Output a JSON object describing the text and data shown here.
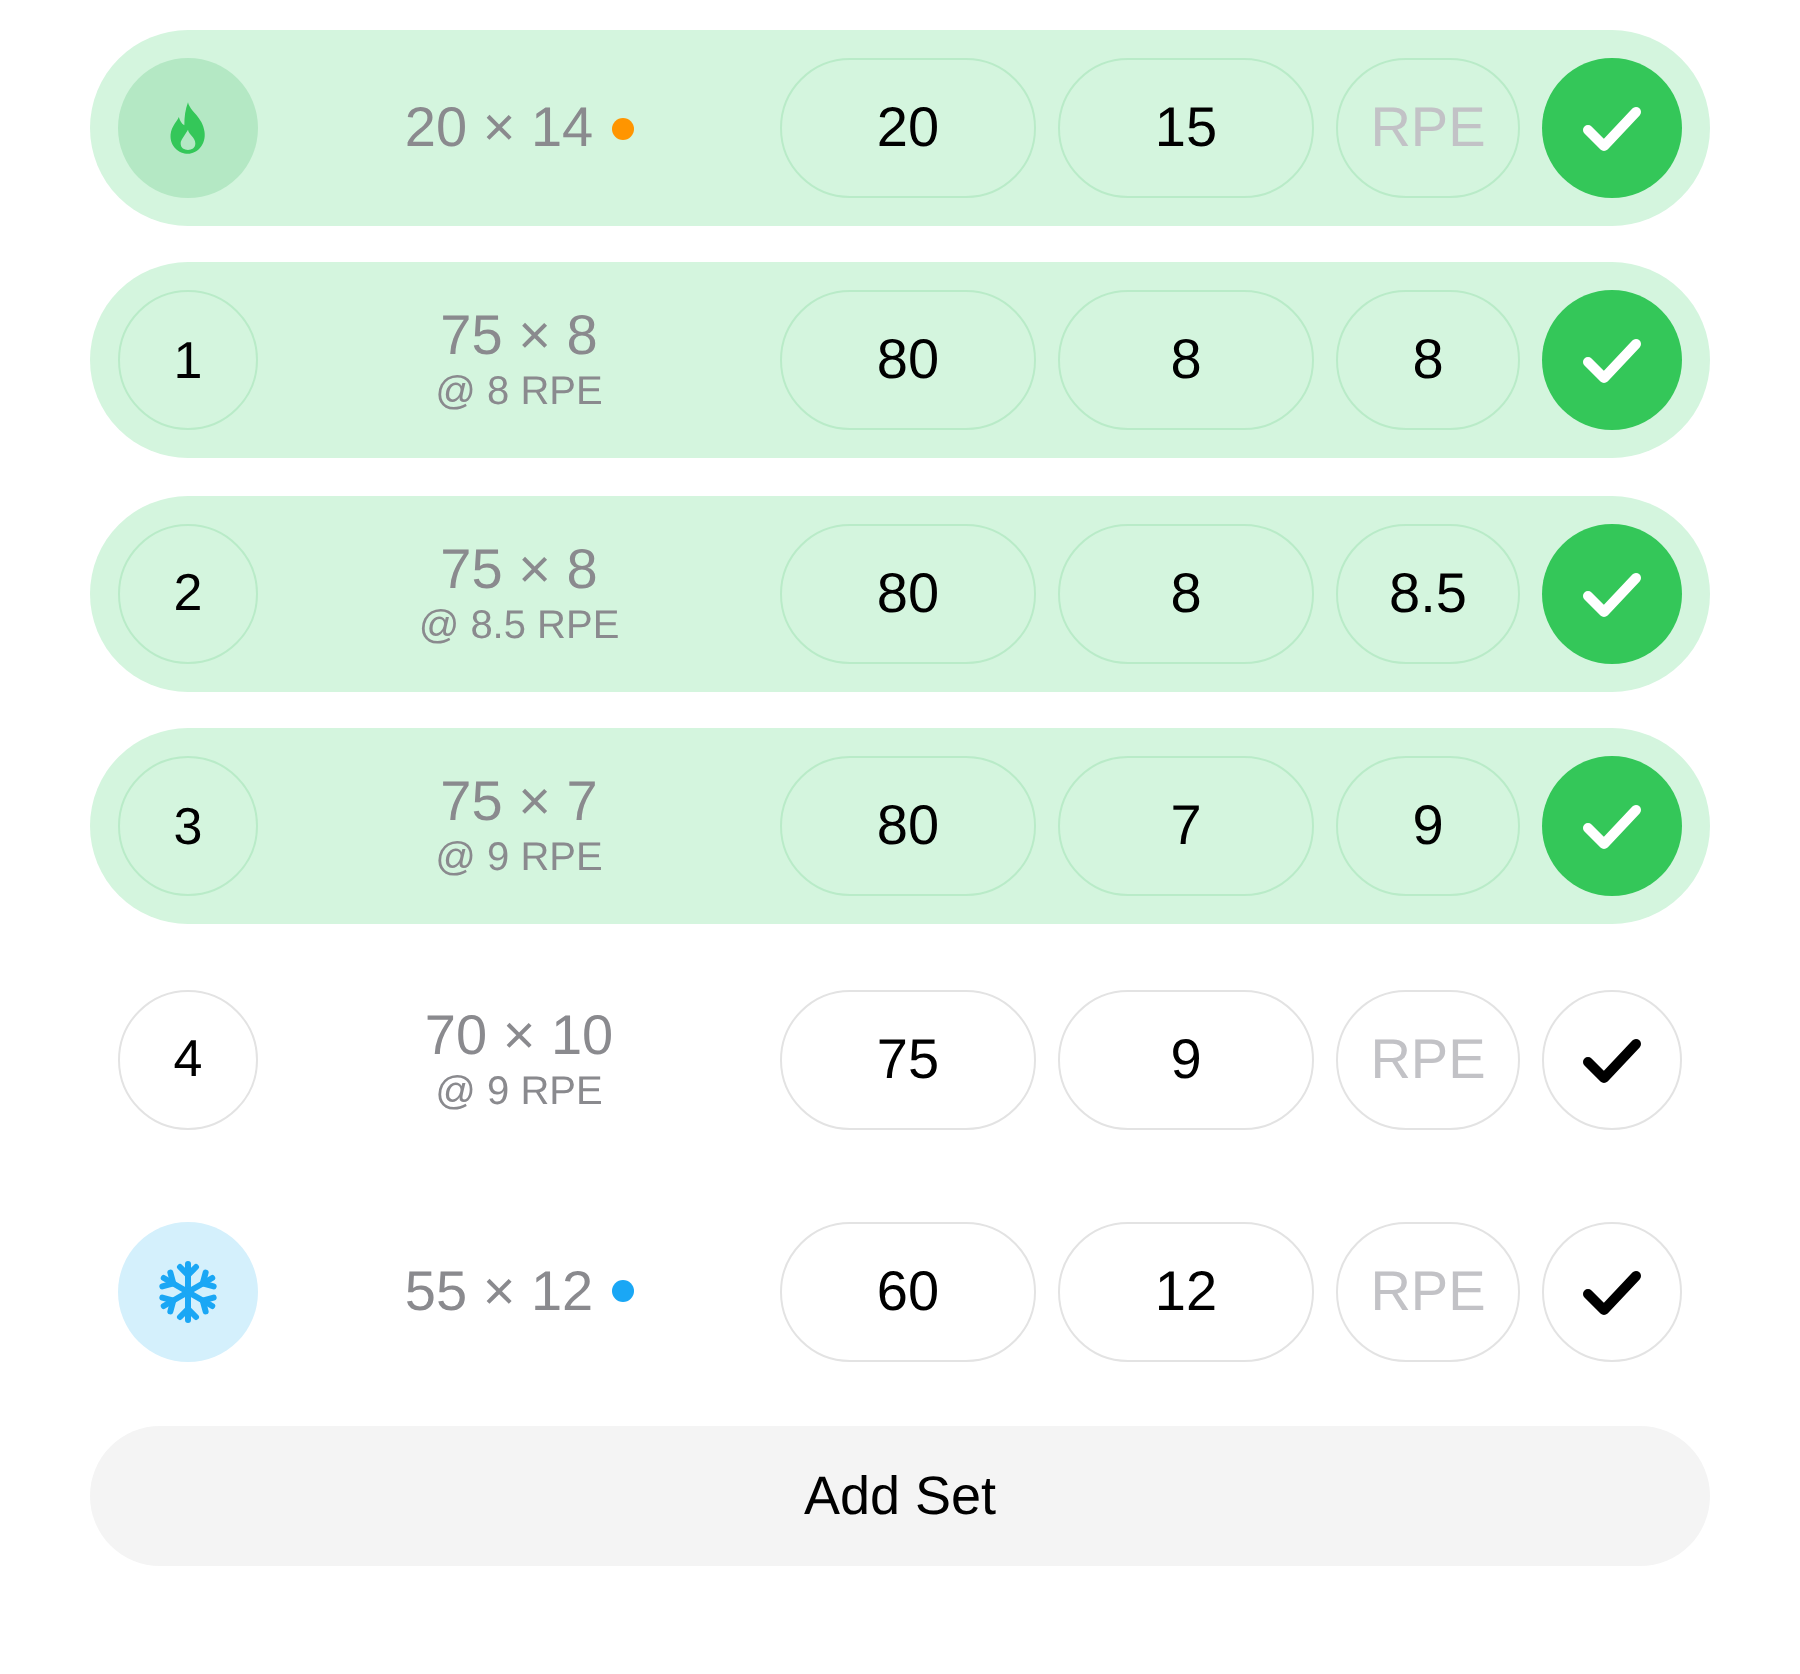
{
  "sets": [
    {
      "kind": "warmup",
      "target": "20 × 14",
      "color": "#ff9500",
      "weight": "20",
      "reps": "15",
      "rpe_placeholder": "RPE",
      "completed": true
    },
    {
      "kind": "working",
      "number": "1",
      "target": "75 × 8",
      "target_rpe": "@ 8 RPE",
      "weight": "80",
      "reps": "8",
      "rpe": "8",
      "completed": true
    },
    {
      "kind": "working",
      "number": "2",
      "target": "75 × 8",
      "target_rpe": "@ 8.5 RPE",
      "weight": "80",
      "reps": "8",
      "rpe": "8.5",
      "completed": true
    },
    {
      "kind": "working",
      "number": "3",
      "target": "75 × 7",
      "target_rpe": "@ 9 RPE",
      "weight": "80",
      "reps": "7",
      "rpe": "9",
      "completed": true
    },
    {
      "kind": "working",
      "number": "4",
      "target": "70 × 10",
      "target_rpe": "@ 9 RPE",
      "weight": "75",
      "reps": "9",
      "rpe_placeholder": "RPE",
      "completed": false
    },
    {
      "kind": "cooldown",
      "target": "55 × 12",
      "color": "#1aa7f5",
      "weight": "60",
      "reps": "12",
      "rpe_placeholder": "RPE",
      "completed": false
    }
  ],
  "add_button": {
    "label": "Add Set"
  }
}
